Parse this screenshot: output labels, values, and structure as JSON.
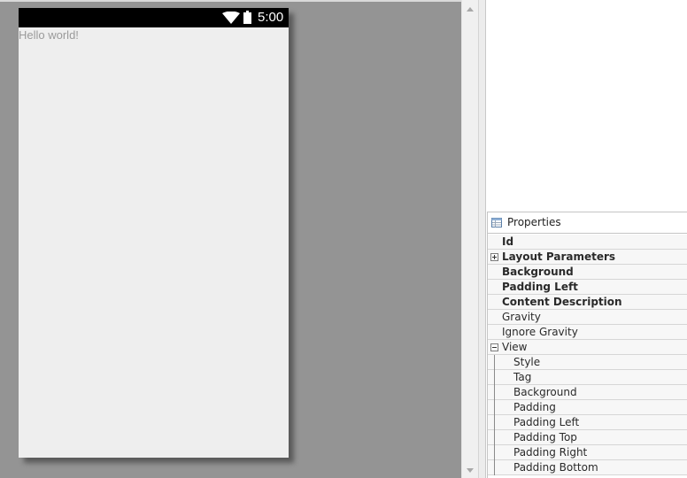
{
  "device": {
    "status_time": "5:00",
    "hello_text": "Hello world!"
  },
  "properties": {
    "title": "Properties",
    "rows": [
      {
        "label": "Id",
        "bold": true,
        "level": 1,
        "expander": null
      },
      {
        "label": "Layout Parameters",
        "bold": true,
        "level": 1,
        "expander": "plus"
      },
      {
        "label": "Background",
        "bold": true,
        "level": 1,
        "expander": null
      },
      {
        "label": "Padding Left",
        "bold": true,
        "level": 1,
        "expander": null
      },
      {
        "label": "Content Description",
        "bold": true,
        "level": 1,
        "expander": null
      },
      {
        "label": "Gravity",
        "bold": false,
        "level": 1,
        "expander": null
      },
      {
        "label": "Ignore Gravity",
        "bold": false,
        "level": 1,
        "expander": null
      },
      {
        "label": "View",
        "bold": false,
        "level": 1,
        "expander": "minus"
      },
      {
        "label": "Style",
        "bold": false,
        "level": 2,
        "expander": null
      },
      {
        "label": "Tag",
        "bold": false,
        "level": 2,
        "expander": null
      },
      {
        "label": "Background",
        "bold": false,
        "level": 2,
        "expander": null
      },
      {
        "label": "Padding",
        "bold": false,
        "level": 2,
        "expander": null
      },
      {
        "label": "Padding Left",
        "bold": false,
        "level": 2,
        "expander": null
      },
      {
        "label": "Padding Top",
        "bold": false,
        "level": 2,
        "expander": null
      },
      {
        "label": "Padding Right",
        "bold": false,
        "level": 2,
        "expander": null
      },
      {
        "label": "Padding Bottom",
        "bold": false,
        "level": 2,
        "expander": null
      }
    ]
  },
  "colors": {
    "canvas_bg": "#949494",
    "device_screen": "#eeeeee",
    "status_bar": "#000000"
  }
}
